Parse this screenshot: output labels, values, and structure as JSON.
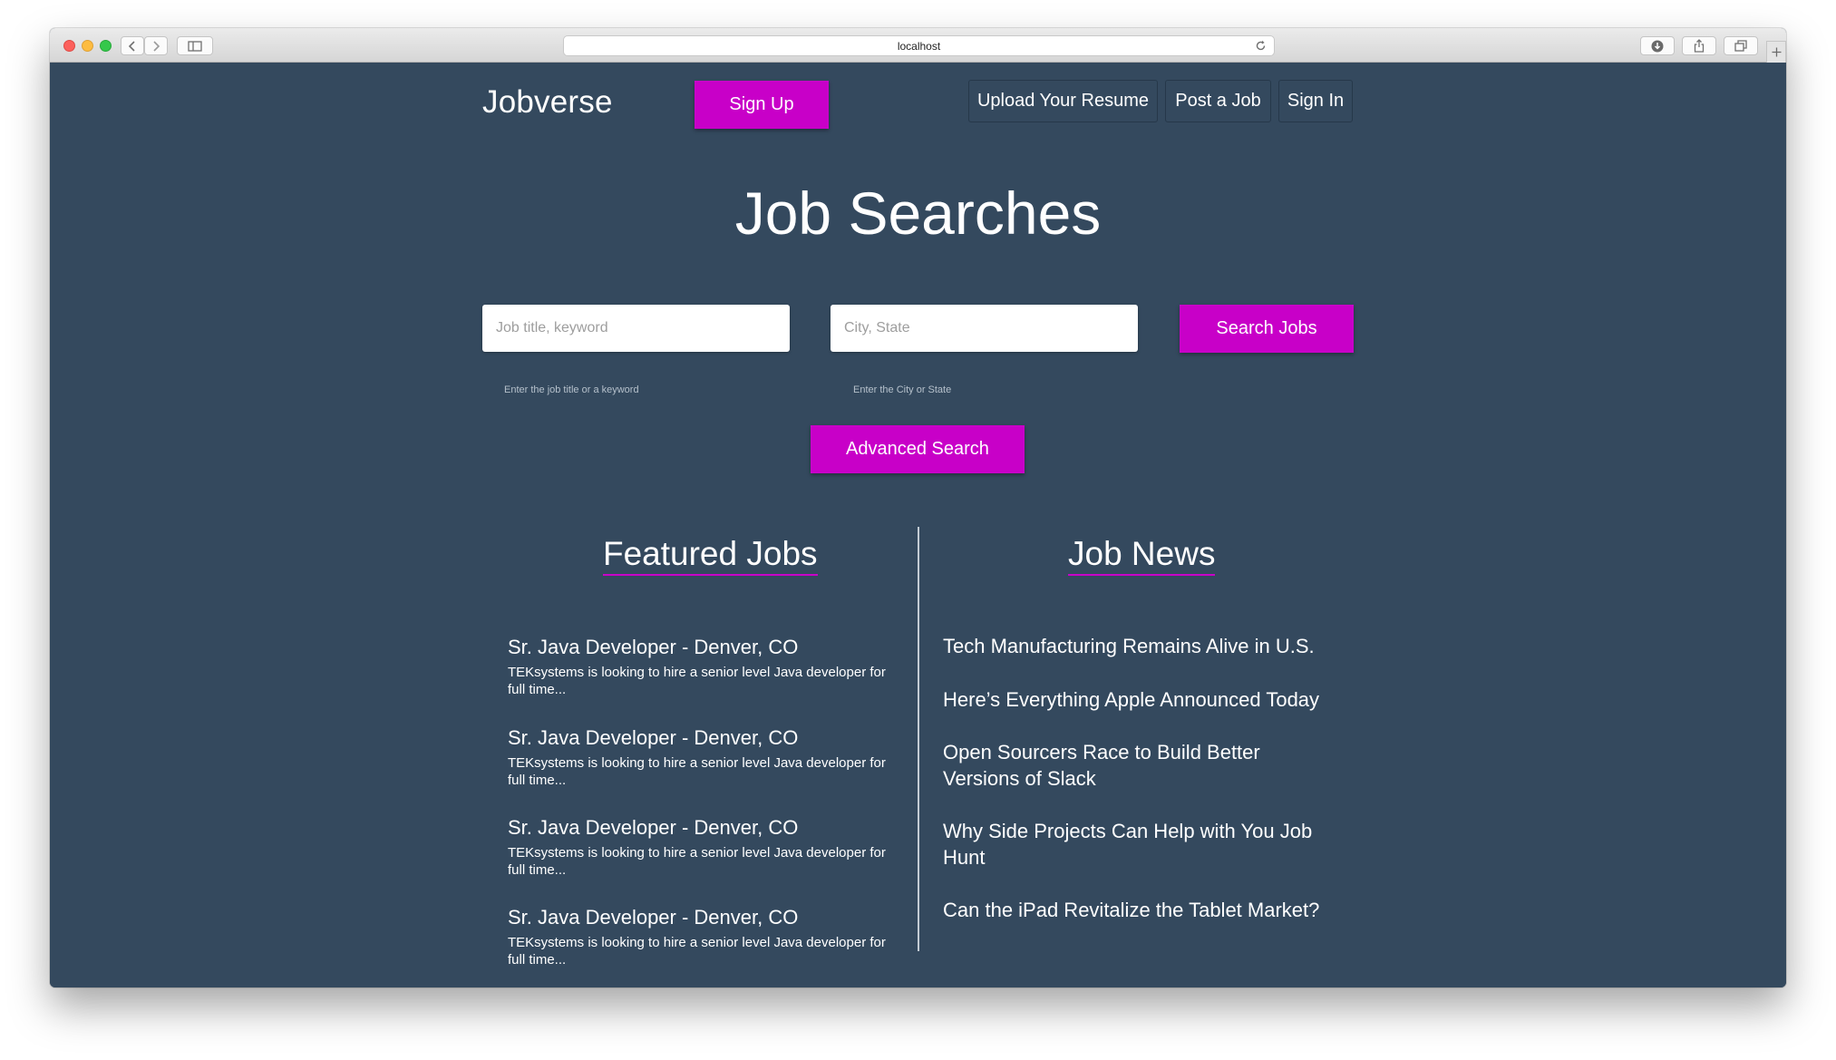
{
  "browser": {
    "url": "localhost"
  },
  "nav": {
    "brand": "Jobverse",
    "signup_label": "Sign Up",
    "links": [
      {
        "label": "Upload Your Resume"
      },
      {
        "label": "Post a Job"
      },
      {
        "label": "Sign In"
      }
    ]
  },
  "hero": {
    "title": "Job Searches"
  },
  "search": {
    "keyword_placeholder": "Job title, keyword",
    "keyword_hint": "Enter the job title or a keyword",
    "location_placeholder": "City, State",
    "location_hint": "Enter the City or State",
    "button_label": "Search Jobs",
    "advanced_label": "Advanced Search"
  },
  "featured": {
    "title": "Featured Jobs",
    "jobs": [
      {
        "title": "Sr. Java Developer - Denver, CO",
        "description": "TEKsystems is looking to hire a senior level Java developer for full time..."
      },
      {
        "title": "Sr. Java Developer - Denver, CO",
        "description": "TEKsystems is looking to hire a senior level Java developer for full time..."
      },
      {
        "title": "Sr. Java Developer - Denver, CO",
        "description": "TEKsystems is looking to hire a senior level Java developer for full time..."
      },
      {
        "title": "Sr. Java Developer - Denver, CO",
        "description": "TEKsystems is looking to hire a senior level Java developer for full time..."
      }
    ]
  },
  "news": {
    "title": "Job News",
    "items": [
      {
        "title": "Tech Manufacturing Remains Alive in U.S."
      },
      {
        "title": "Here’s Everything Apple Announced Today"
      },
      {
        "title": "Open Sourcers Race to Build Better Versions of Slack"
      },
      {
        "title": "Why Side Projects Can Help with You Job Hunt"
      },
      {
        "title": "Can the iPad Revitalize the Tablet Market?"
      }
    ]
  },
  "colors": {
    "background": "#34495e",
    "accent": "#c800c8",
    "text": "#ffffff"
  },
  "icons": [
    "back-icon",
    "forward-icon",
    "sidebar-icon",
    "reload-icon",
    "download-icon",
    "share-icon",
    "tabs-icon",
    "new-tab-icon"
  ]
}
